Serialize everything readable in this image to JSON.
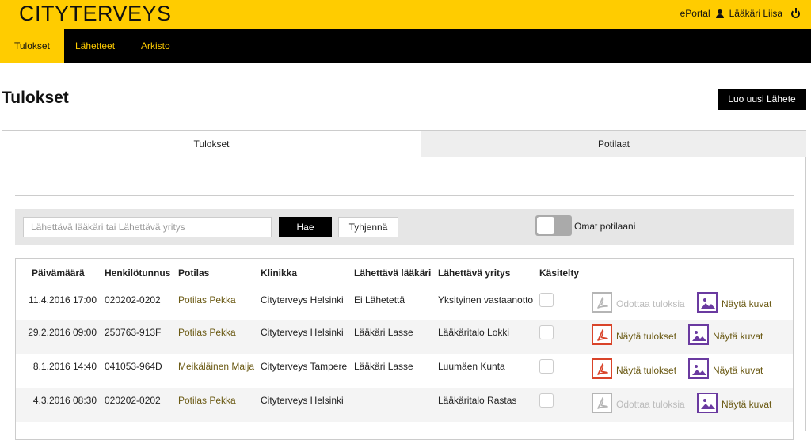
{
  "header": {
    "logo": "CITYTERVEYS",
    "eportal_label": "ePortal",
    "user_name": "Lääkäri Liisa"
  },
  "nav": {
    "items": [
      {
        "label": "Tulokset"
      },
      {
        "label": "Lähetteet"
      },
      {
        "label": "Arkisto"
      }
    ]
  },
  "page": {
    "title": "Tulokset",
    "new_button_label": "Luo uusi Lähete"
  },
  "tabs": [
    {
      "label": "Tulokset"
    },
    {
      "label": "Potilaat"
    }
  ],
  "search": {
    "placeholder": "Lähettävä lääkäri tai Lähettävä yritys",
    "search_button": "Hae",
    "clear_button": "Tyhjennä",
    "toggle_label": "Omat potilaani"
  },
  "table": {
    "headers": [
      "Päivämäärä",
      "Henkilötunnus",
      "Potilas",
      "Klinikka",
      "Lähettävä lääkäri",
      "Lähettävä yritys",
      "Käsitelty"
    ],
    "rows": [
      {
        "date": "11.4.2016 17:00",
        "ssn": "020202-0202",
        "patient": "Potilas Pekka",
        "clinic": "Cityterveys Helsinki",
        "doctor": "Ei Lähetettä",
        "company": "Yksityinen vastaanotto",
        "result_label": "Odottaa tuloksia",
        "result_ready": false,
        "images_label": "Näytä kuvat"
      },
      {
        "date": "29.2.2016 09:00",
        "ssn": "250763-913F",
        "patient": "Potilas Pekka",
        "clinic": "Cityterveys Helsinki",
        "doctor": "Lääkäri Lasse",
        "company": "Lääkäritalo Lokki",
        "result_label": "Näytä tulokset",
        "result_ready": true,
        "images_label": "Näytä kuvat"
      },
      {
        "date": "8.1.2016 14:40",
        "ssn": "041053-964D",
        "patient": "Meikäläinen Maija",
        "clinic": "Cityterveys Tampere",
        "doctor": "Lääkäri Lasse",
        "company": "Luumäen Kunta",
        "result_label": "Näytä tulokset",
        "result_ready": true,
        "images_label": "Näytä kuvat"
      },
      {
        "date": "4.3.2016 08:30",
        "ssn": "020202-0202",
        "patient": "Potilas Pekka",
        "clinic": "Cityterveys Helsinki",
        "doctor": "",
        "company": "Lääkäritalo Rastas",
        "result_label": "Odottaa tuloksia",
        "result_ready": false,
        "images_label": "Näytä kuvat"
      }
    ]
  },
  "colors": {
    "brand_yellow": "#ffcc00",
    "pdf_ready": "#d9442a",
    "pdf_pending": "#b5b5b5",
    "image_icon": "#6a3aa0",
    "link_olive": "#6b5a14"
  },
  "icons": {
    "user": "user-icon",
    "power": "power-icon",
    "pdf": "pdf-icon",
    "image": "image-icon"
  }
}
